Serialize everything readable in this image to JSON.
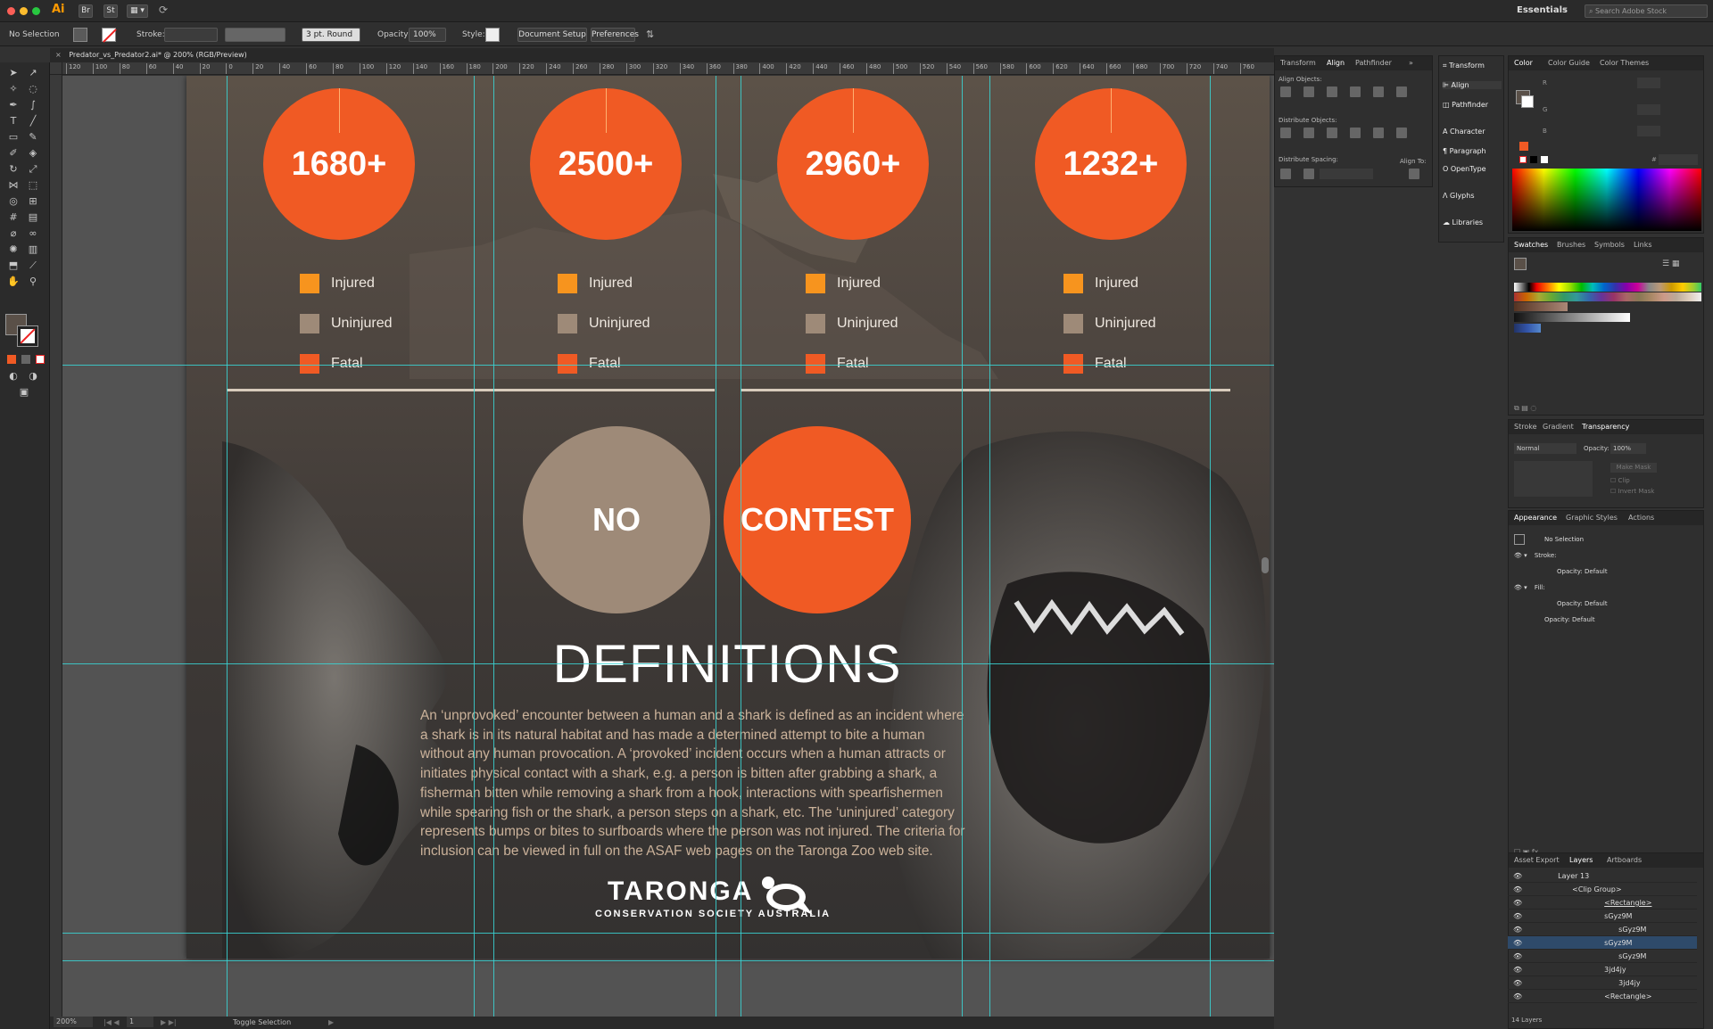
{
  "app": {
    "logo": "Ai",
    "workspace": "Essentials",
    "search_placeholder": "Search Adobe Stock",
    "bridge": "Br",
    "stock": "St"
  },
  "control": {
    "selection": "No Selection",
    "stroke_label": "Stroke:",
    "brush": "3 pt. Round",
    "opacity_label": "Opacity:",
    "opacity": "100%",
    "style_label": "Style:",
    "doc_setup": "Document Setup",
    "preferences": "Preferences"
  },
  "document": {
    "tab": "Predator_vs_Predator2.ai* @ 200% (RGB/Preview)",
    "zoom": "200%",
    "artboard": "1",
    "status": "Toggle Selection"
  },
  "ruler": {
    "h": [
      "120",
      "100",
      "80",
      "60",
      "40",
      "20",
      "0",
      "20",
      "40",
      "60",
      "80",
      "100",
      "120",
      "140",
      "160",
      "180",
      "200",
      "220",
      "240",
      "260",
      "280",
      "300",
      "320",
      "340",
      "360",
      "380",
      "400",
      "420",
      "440",
      "460",
      "480",
      "500",
      "520",
      "540",
      "560",
      "580",
      "600",
      "620",
      "640",
      "660",
      "680",
      "700",
      "720",
      "740",
      "760"
    ]
  },
  "stats": [
    {
      "value": "1680+",
      "legend": [
        "Injured",
        "Uninjured",
        "Fatal"
      ]
    },
    {
      "value": "2500+",
      "legend": [
        "Injured",
        "Uninjured",
        "Fatal"
      ]
    },
    {
      "value": "2960+",
      "legend": [
        "Injured",
        "Uninjured",
        "Fatal"
      ]
    },
    {
      "value": "1232+",
      "legend": [
        "Injured",
        "Uninjured",
        "Fatal"
      ]
    }
  ],
  "colors": {
    "injured": "#f7941e",
    "uninjured": "#9e8a78",
    "fatal": "#f05a24",
    "no_circle": "#9e8a78",
    "guide": "#3ad6d6"
  },
  "verdict": {
    "left": "NO",
    "right": "CONTEST"
  },
  "definitions": {
    "title": "DEFINITIONS",
    "lines": [
      "An ‘unprovoked’ encounter between a human and a shark is defined as an incident where",
      "a shark is in its natural habitat and has made a determined attempt to bite a human",
      "without any human provocation. A ‘provoked’ incident occurs when a human attracts or",
      "initiates physical contact with a shark, e.g. a person is bitten after grabbing a shark, a",
      "fisherman bitten while removing a shark from a hook, interactions with spearfishermen",
      "while spearing fish or the shark, a person steps on a shark, etc. The ‘uninjured’ category",
      "represents bumps or bites to surfboards where the person was not injured. The criteria for",
      "inclusion can be viewed in full on the ASAF web pages on the Taronga Zoo web site."
    ]
  },
  "logo": {
    "name": "TARONGA",
    "sub": "CONSERVATION SOCIETY AUSTRALIA"
  },
  "panels": {
    "align_tabs": [
      "Transform",
      "Align",
      "Pathfinder"
    ],
    "align_objects": "Align Objects:",
    "distribute_objects": "Distribute Objects:",
    "distribute_spacing": "Distribute Spacing:",
    "align_to": "Align To:",
    "dock": [
      "Transform",
      "Align",
      "Pathfinder",
      "Character",
      "Paragraph",
      "OpenType",
      "Glyphs",
      "Libraries"
    ],
    "color_tabs": [
      "Color",
      "Color Guide",
      "Color Themes"
    ],
    "color_channels": [
      "R",
      "G",
      "B"
    ],
    "hex": "#",
    "swatch_tabs": [
      "Swatches",
      "Brushes",
      "Symbols",
      "Links"
    ],
    "transparency_tabs": [
      "Stroke",
      "Gradient",
      "Transparency"
    ],
    "blend": "Normal",
    "trans_opacity_label": "Opacity:",
    "trans_opacity": "100%",
    "make_mask": "Make Mask",
    "clip": "Clip",
    "invert_mask": "Invert Mask",
    "appearance_tabs": [
      "Appearance",
      "Graphic Styles",
      "Actions"
    ],
    "appearance": [
      "No Selection",
      "Stroke:",
      "Opacity: Default",
      "Fill:",
      "Opacity: Default",
      "Opacity: Default"
    ],
    "layer_tabs": [
      "Asset Export",
      "Layers",
      "Artboards"
    ],
    "layers": [
      "Layer 13",
      "<Clip Group>",
      "<Rectangle>",
      "sGyz9M",
      "sGyz9M",
      "sGyz9M",
      "sGyz9M",
      "3jd4jy",
      "3jd4jy",
      "<Rectangle>"
    ],
    "layer_count": "14 Layers"
  }
}
